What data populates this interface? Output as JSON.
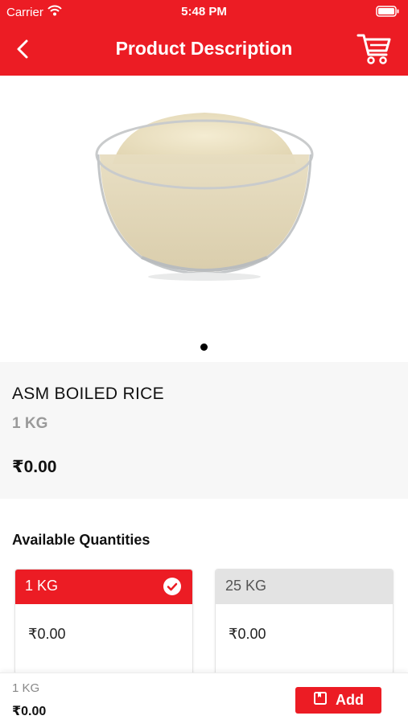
{
  "status_bar": {
    "carrier": "Carrier",
    "time": "5:48 PM"
  },
  "nav": {
    "title": "Product Description"
  },
  "product": {
    "name": "ASM BOILED RICE",
    "unit": "1 KG",
    "price": "₹0.00",
    "image_icon": "rice-bowl",
    "carousel_pages": 1,
    "carousel_active": 0
  },
  "quantities": {
    "heading": "Available Quantities",
    "options": [
      {
        "label": "1 KG",
        "price": "₹0.00",
        "selected": true
      },
      {
        "label": "25 KG",
        "price": "₹0.00",
        "selected": false
      }
    ]
  },
  "bottom_bar": {
    "unit": "1 KG",
    "price": "₹0.00",
    "add_label": "Add"
  },
  "colors": {
    "brand_red": "#ec1c24",
    "unselected_grey": "#e3e3e3",
    "info_bg": "#f7f7f7"
  }
}
